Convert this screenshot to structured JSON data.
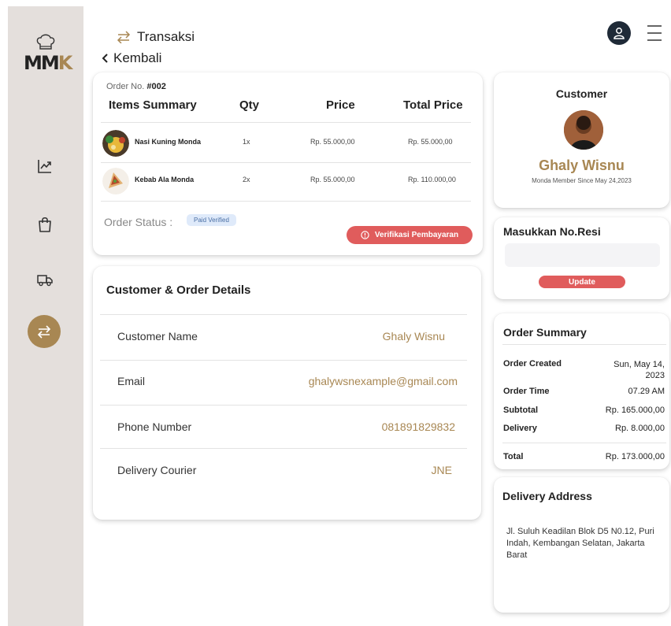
{
  "brand": {
    "logo_text_m": "MM",
    "logo_text_k": "K",
    "accent_color": "#a88753",
    "danger_color": "#e05c5c"
  },
  "header": {
    "title": "Transaksi",
    "back_label": "Kembali"
  },
  "sidebar": {
    "items": [
      {
        "icon": "chart-icon"
      },
      {
        "icon": "shopping-bag-icon"
      },
      {
        "icon": "truck-icon"
      },
      {
        "icon": "transfer-arrows-icon",
        "active": true
      }
    ]
  },
  "order": {
    "number_label": "Order No.",
    "number": "#002",
    "columns": {
      "items": "Items Summary",
      "qty": "Qty",
      "price": "Price",
      "total": "Total Price"
    },
    "items": [
      {
        "name": "Nasi Kuning Monda",
        "qty": "1x",
        "price": "Rp. 55.000,00",
        "total": "Rp. 55.000,00"
      },
      {
        "name": "Kebab Ala Monda",
        "qty": "2x",
        "price": "Rp. 55.000,00",
        "total": "Rp. 110.000,00"
      }
    ],
    "status_label": "Order Status :",
    "status_value": "Paid Verified",
    "verify_button": "Verifikasi Pembayaran"
  },
  "details": {
    "title": "Customer & Order Details",
    "rows": [
      {
        "label": "Customer Name",
        "value": "Ghaly Wisnu"
      },
      {
        "label": "Email",
        "value": "ghalywsnexample@gmail.com"
      },
      {
        "label": "Phone Number",
        "value": "081891829832"
      },
      {
        "label": "Delivery Courier",
        "value": "JNE"
      }
    ]
  },
  "customer": {
    "heading": "Customer",
    "name": "Ghaly Wisnu",
    "member_since": "Monda Member Since May 24,2023"
  },
  "resi": {
    "heading": "Masukkan No.Resi",
    "input_value": "",
    "button": "Update"
  },
  "summary": {
    "heading": "Order Summary",
    "rows": [
      {
        "label": "Order Created",
        "value": "Sun, May 14, 2023"
      },
      {
        "label": "Order Time",
        "value": "07.29 AM"
      },
      {
        "label": "Subtotal",
        "value": "Rp. 165.000,00"
      },
      {
        "label": "Delivery",
        "value": "Rp. 8.000,00"
      },
      {
        "label": "Total",
        "value": "Rp. 173.000,00"
      }
    ]
  },
  "address": {
    "heading": "Delivery Address",
    "text": "Jl. Suluh Keadilan Blok D5 N0.12, Puri Indah, Kembangan Selatan, Jakarta Barat"
  }
}
